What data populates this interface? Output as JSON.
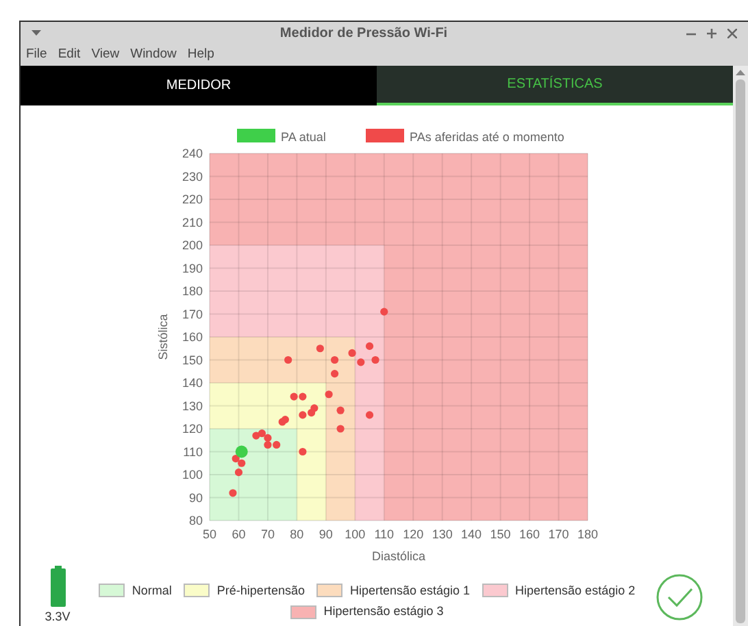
{
  "window": {
    "title": "Medidor de Pressão Wi-Fi"
  },
  "menu": [
    "File",
    "Edit",
    "View",
    "Window",
    "Help"
  ],
  "tabs": [
    {
      "label": "MEDIDOR",
      "selected": false
    },
    {
      "label": "ESTATÍSTICAS",
      "selected": true
    }
  ],
  "chart": {
    "chart_data": {
      "type": "scatter",
      "grid": true,
      "legend": true,
      "xlabel": "Diastólica",
      "ylabel": "Sistólica",
      "xlim": [
        50,
        180
      ],
      "ylim": [
        80,
        240
      ],
      "xticks": [
        50,
        60,
        70,
        80,
        90,
        100,
        110,
        120,
        130,
        140,
        150,
        160,
        170,
        180
      ],
      "yticks": [
        80,
        90,
        100,
        110,
        120,
        130,
        140,
        150,
        160,
        170,
        180,
        190,
        200,
        210,
        220,
        230,
        240
      ],
      "series": [
        {
          "name": "PA atual",
          "color": "#3fcf4a",
          "x": [
            61
          ],
          "values": [
            110
          ]
        },
        {
          "name": "PAs aferidas até o momento",
          "color": "#f04a4a",
          "x": [
            58,
            59,
            61,
            60,
            66,
            68,
            70,
            70,
            73,
            75,
            76,
            77,
            79,
            82,
            82,
            82,
            85,
            86,
            88,
            91,
            93,
            93,
            95,
            95,
            99,
            102,
            105,
            107,
            105,
            110
          ],
          "values": [
            92,
            107,
            105,
            101,
            117,
            118,
            116,
            113,
            113,
            123,
            124,
            150,
            134,
            134,
            126,
            110,
            127,
            129,
            155,
            135,
            150,
            144,
            128,
            120,
            153,
            149,
            156,
            150,
            126,
            171
          ]
        }
      ]
    }
  },
  "zone_legend": [
    {
      "label": "Normal",
      "color": "#d6f8d6"
    },
    {
      "label": "Pré-hipertensão",
      "color": "#fafcc8"
    },
    {
      "label": "Hipertensão estágio 1",
      "color": "#fcdcbd"
    },
    {
      "label": "Hipertensão estágio 2",
      "color": "#fbc9cf"
    },
    {
      "label": "Hipertensão estágio 3",
      "color": "#f8b2b2"
    }
  ],
  "battery": {
    "reading": "3.3V",
    "level": 1
  }
}
